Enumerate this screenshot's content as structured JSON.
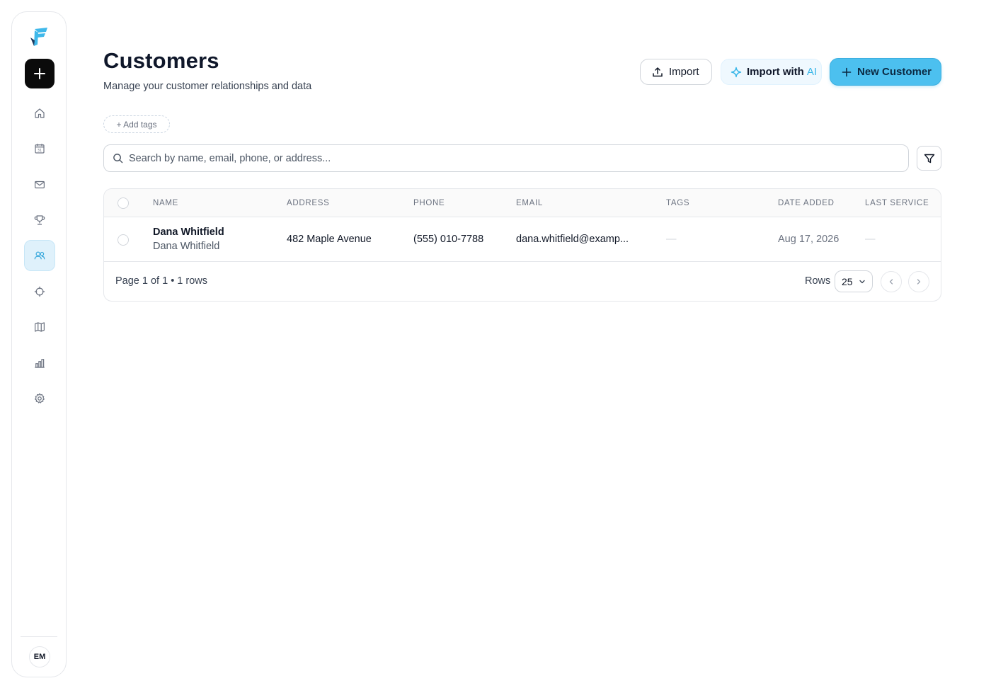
{
  "sidebar": {
    "logo_icon": "brand-logo",
    "new_icon": "plus-icon",
    "items": [
      {
        "name": "home",
        "icon": "home-icon",
        "active": false
      },
      {
        "name": "calendar",
        "icon": "calendar-icon",
        "label": "31",
        "active": false
      },
      {
        "name": "mail",
        "icon": "mail-icon",
        "active": false
      },
      {
        "name": "trophy",
        "icon": "trophy-icon",
        "active": false
      },
      {
        "name": "customers",
        "icon": "users-icon",
        "active": true
      },
      {
        "name": "target",
        "icon": "crosshair-icon",
        "active": false
      },
      {
        "name": "map",
        "icon": "map-icon",
        "active": false
      },
      {
        "name": "reports",
        "icon": "bar-chart-icon",
        "active": false
      },
      {
        "name": "settings",
        "icon": "gear-icon",
        "active": false
      }
    ],
    "avatar_initials": "EM"
  },
  "header": {
    "title": "Customers",
    "subtitle": "Manage your customer relationships and data",
    "import_label": "Import",
    "import_ai_label": "Import with",
    "import_ai_accent": "AI",
    "new_customer_label": "New Customer"
  },
  "tags": {
    "add_label": "+ Add tags"
  },
  "search": {
    "placeholder": "Search by name, email, phone, or address...",
    "value": ""
  },
  "table": {
    "columns": [
      "NAME",
      "ADDRESS",
      "PHONE",
      "EMAIL",
      "TAGS",
      "DATE ADDED",
      "LAST SERVICE"
    ],
    "rows": [
      {
        "name": "Dana Whitfield",
        "name_secondary": "Dana Whitfield",
        "address": "482 Maple Avenue",
        "phone": "(555) 010-7788",
        "email": "dana.whitfield@examp...",
        "tags": "—",
        "date_added": "Aug 17, 2026",
        "last_service": "—"
      }
    ],
    "footer_text": "Page 1 of 1 • 1 rows",
    "rows_label": "Rows",
    "rows_per_page": "25"
  },
  "colors": {
    "accent": "#4cc0ef",
    "accent_light": "#dff1fb",
    "dark_button": "#0b0b0b"
  }
}
